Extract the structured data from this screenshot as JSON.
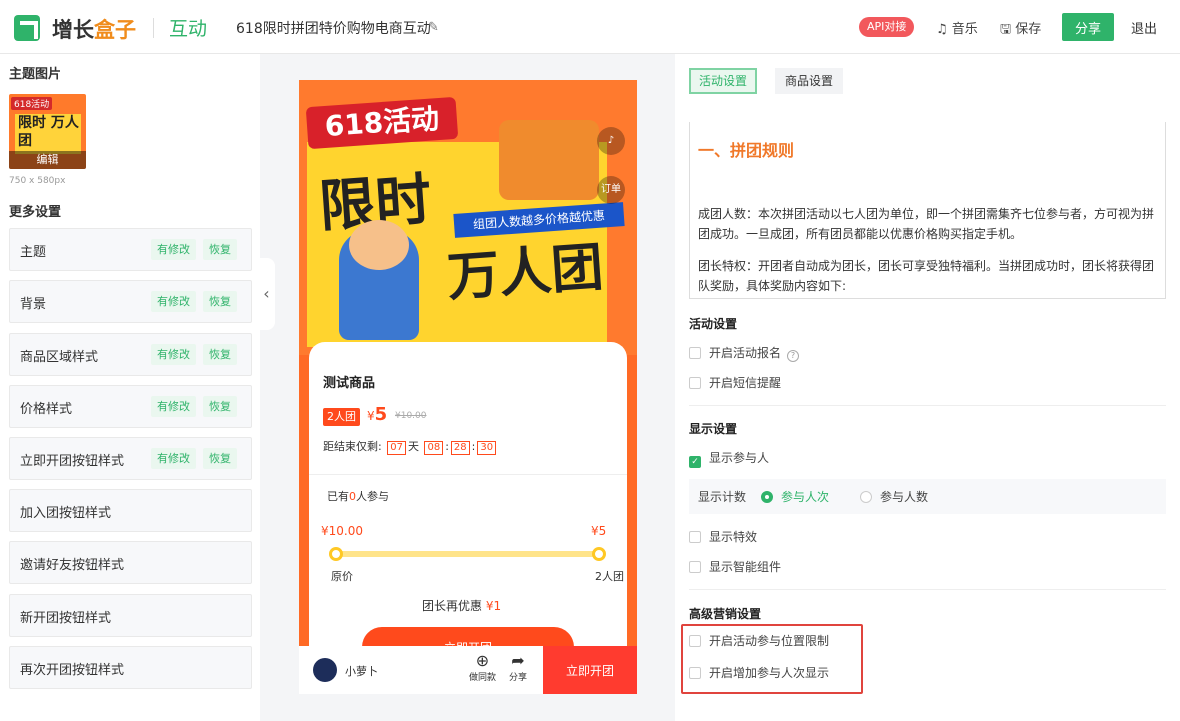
{
  "header": {
    "logo_a": "增长",
    "logo_b": "盒子",
    "module": "互动",
    "title": "618限时拼团特价购物电商互动",
    "api_label": "API对接",
    "music_label": "音乐",
    "save_label": "保存",
    "share_label": "分享",
    "exit_label": "退出"
  },
  "left": {
    "theme_image_title": "主题图片",
    "thumb_badge": "618活动",
    "thumb_big": "限时 万人团",
    "thumb_edit": "编辑",
    "thumb_size": "750 x 580px",
    "more_title": "更多设置",
    "modified_label": "有修改",
    "restore_label": "恢复",
    "items": [
      {
        "label": "主题",
        "modified": true
      },
      {
        "label": "背景",
        "modified": true
      },
      {
        "label": "商品区域样式",
        "modified": true
      },
      {
        "label": "价格样式",
        "modified": true
      },
      {
        "label": "立即开团按钮样式",
        "modified": true
      },
      {
        "label": "加入团按钮样式",
        "modified": false
      },
      {
        "label": "邀请好友按钮样式",
        "modified": false
      },
      {
        "label": "新开团按钮样式",
        "modified": false
      },
      {
        "label": "再次开团按钮样式",
        "modified": false
      }
    ]
  },
  "preview": {
    "badge": "618活动",
    "big1": "限时",
    "big2": "万人团",
    "slogan": "组团人数越多价格越优惠",
    "order_label": "订单",
    "product_name": "测试商品",
    "group_tag": "2人团",
    "currency": "¥",
    "price": "5",
    "original_price": "¥10.00",
    "countdown_label": "距结束仅剩:",
    "countdown": {
      "days": "07",
      "day_unit": "天",
      "h": "08",
      "m": "28",
      "s": "30"
    },
    "joined_prefix": "已有",
    "joined_count": "0",
    "joined_suffix": "人参与",
    "price_start": "¥10.00",
    "price_end": "¥5",
    "progress_fraction": 1.0,
    "label_start": "原价",
    "label_end": "2人团",
    "leader_discount_label": "团长再优惠",
    "leader_discount_value": "¥1",
    "open_group_label": "立即开团",
    "user_name": "小萝卜",
    "make_same_label": "做同款",
    "share_label": "分享",
    "bottom_open_label": "立即开团"
  },
  "right": {
    "tab_activity": "活动设置",
    "tab_goods": "商品设置",
    "rules_heading": "一、拼团规则",
    "rules_p1": "成团人数：本次拼团活动以七人团为单位，即一个拼团需集齐七位参与者，方可视为拼团成功。一旦成团，所有团员都能以优惠价格购买指定手机。",
    "rules_p2": "团长特权：开团者自动成为团长，团长可享受独特福利。当拼团成功时，团长将获得团队奖励，具体奖励内容如下:",
    "activity_settings": "活动设置",
    "enable_signup": "开启活动报名",
    "enable_sms": "开启短信提醒",
    "display_settings": "显示设置",
    "show_participants": "显示参与人",
    "count_label": "显示计数",
    "radio_times": "参与人次",
    "radio_people": "参与人数",
    "show_effects": "显示特效",
    "show_smart": "显示智能组件",
    "advanced_settings": "高级营销设置",
    "location_limit": "开启活动参与位置限制",
    "extra_count": "开启增加参与人次显示"
  },
  "colors": {
    "brand_green": "#2fb36a",
    "accent_orange": "#f08c1c",
    "price_red": "#ff4a1c",
    "highlight": "#e0443d"
  }
}
